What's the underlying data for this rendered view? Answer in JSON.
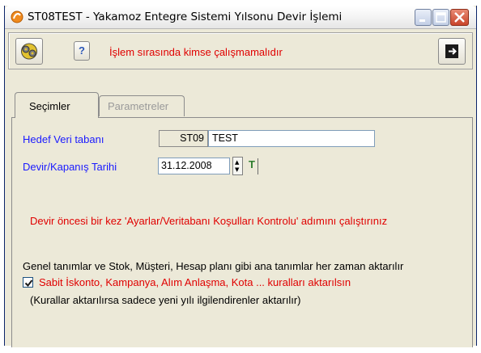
{
  "window": {
    "title": "ST08TEST - Yakamoz Entegre Sistemi Yılsonu Devir İşlemi"
  },
  "toolbar": {
    "run_icon": "gears-icon",
    "help_label": "?",
    "warning": "İşlem sırasında kimse çalışmamalıdır",
    "exit_icon": "exit-door-icon"
  },
  "tabs": [
    {
      "label": "Seçimler",
      "active": true
    },
    {
      "label": "Parametreler",
      "active": false
    }
  ],
  "form": {
    "target_db_label": "Hedef Veri tabanı",
    "target_db_code": "ST09",
    "target_db_name": "TEST",
    "date_label": "Devir/Kapanış Tarihi",
    "date_value": "31.12.2008",
    "today_button": "T",
    "pre_check_note": "Devir öncesi bir kez 'Ayarlar/Veritabanı Koşulları Kontrolu' adımını çalıştırınız",
    "general_note": "Genel tanımlar ve Stok, Müşteri, Hesap planı gibi ana tanımlar her zaman aktarılır",
    "rules_checkbox_label": "Sabit İskonto, Kampanya, Alım Anlaşma, Kota ... kuralları aktarılsın",
    "rules_checked": true,
    "rules_note": "(Kurallar aktarılırsa sadece yeni yılı ilgilendirenler aktarılır)"
  },
  "colors": {
    "label_blue": "#1a1aff",
    "warning_red": "#e00000",
    "tab_inactive_text": "#9a9a9a",
    "window_bg": "#ece9d8"
  }
}
